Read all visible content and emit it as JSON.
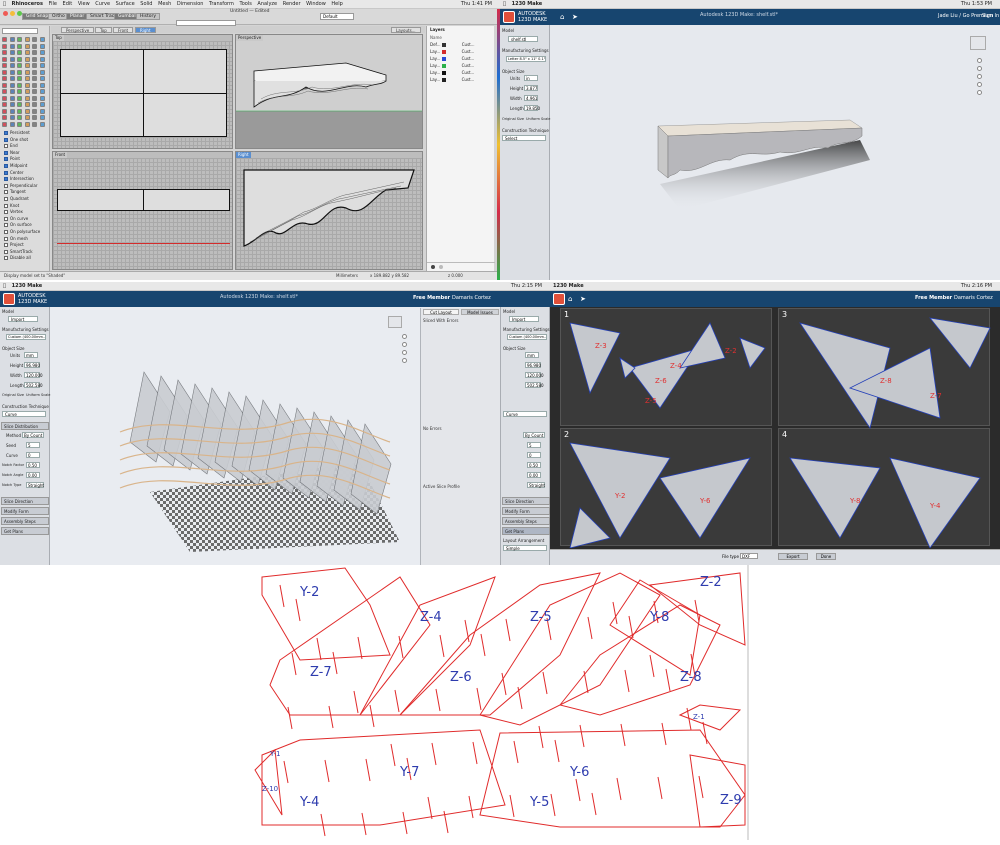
{
  "rhino": {
    "menubar": [
      "Rhinoceros",
      "File",
      "Edit",
      "View",
      "Curve",
      "Surface",
      "Solid",
      "Mesh",
      "Dimension",
      "Transform",
      "Tools",
      "Analyze",
      "Render",
      "Window",
      "Help"
    ],
    "clock": "Thu 1:41 PM",
    "window_title": "Untitled — Edited",
    "toolbar_tabs": [
      "Grid Snap",
      "Ortho",
      "Planar",
      "Smart Track",
      "Gumball",
      "History"
    ],
    "command_value": "Default",
    "viewport_tabs": [
      "Perspective",
      "Top",
      "Front",
      "Right",
      "Layouts..."
    ],
    "viewports": [
      "Top",
      "Perspective",
      "Front",
      "Right"
    ],
    "osnaps": [
      "Persistent",
      "One shot",
      "End",
      "Near",
      "Point",
      "Midpoint",
      "Center",
      "Intersection",
      "Perpendicular",
      "Tangent",
      "Quadrant",
      "Knot",
      "Vertex",
      "On curve",
      "On surface",
      "On polysurface",
      "On mesh",
      "Project",
      "SmartTrack",
      "Disable all"
    ],
    "layers_header": "Layers",
    "layers_name_col": "Name",
    "layers": [
      {
        "name": "Def...",
        "mat": "Cust...",
        "color": "#333333"
      },
      {
        "name": "Lay...",
        "mat": "Cust...",
        "color": "#d42b2b"
      },
      {
        "name": "Lay...",
        "mat": "Cust...",
        "color": "#2b4ad4"
      },
      {
        "name": "Lay...",
        "mat": "Cust...",
        "color": "#2bb04a"
      },
      {
        "name": "Lay...",
        "mat": "Cust...",
        "color": "#111111"
      },
      {
        "name": "Lay...",
        "mat": "Cust...",
        "color": "#222222"
      }
    ],
    "status": "Display model set to \"Shaded\"",
    "status_units": "Millimeters",
    "status_coords": "x 189.882   y 89.582",
    "status_z": "z 0.000"
  },
  "make1": {
    "menubar": [
      "1230 Make"
    ],
    "clock": "Thu 1:53 PM",
    "brand_top": "AUTODESK",
    "brand_bottom": "123D MAKE",
    "title": "Autodesk 123D Make: shelf.stl*",
    "user": "Jade Liu / Go Premium",
    "signin": "Sign In",
    "model_label": "Model",
    "import_btn": "shelf.stl",
    "manufacturing_label": "Manufacturing Settings",
    "manufacturing_value": "Letter 8.5\" x 11\" 0.1\"",
    "object_size": "Object Size",
    "units_label": "Units",
    "units_value": "in",
    "height_label": "Height",
    "height_value": "3.877",
    "width_label": "Width",
    "width_value": "4.961",
    "length_label": "Length",
    "length_value": "19.850",
    "original_size": "Original Size",
    "uniform_scale": "Uniform Scale",
    "technique_label": "Construction Technique",
    "technique_value": "Select"
  },
  "make2": {
    "menubar": [
      "1230 Make"
    ],
    "clock": "Thu 2:15 PM",
    "brand_top": "AUTODESK",
    "brand_bottom": "123D MAKE",
    "title": "Autodesk 123D Make: shelf.stl*",
    "member": "Free Member",
    "user": "Damaris Cortez",
    "model_label": "Model",
    "import_btn": "Import",
    "manufacturing_label": "Manufacturing Settings",
    "manufacturing_value": "Custom (400.00mm...",
    "object_size": "Object Size",
    "units_label": "Units",
    "units_value": "mm",
    "height_label": "Height",
    "height_value": "96.980",
    "width_label": "Width",
    "width_value": "120.000",
    "length_label": "Length",
    "length_value": "502.580",
    "original_size": "Original Size",
    "uniform_scale": "Uniform Scale",
    "technique_label": "Construction Technique",
    "technique_value": "Curve",
    "slice_dist": "Slice Distribution",
    "method_label": "Method",
    "method_value": "By Count",
    "first_label": "Seed",
    "first_value": "5",
    "curve_label": "Curve",
    "curve_value": "0",
    "notch_factor_label": "Notch Factor",
    "notch_factor_value": "0.50",
    "notch_angle_label": "Notch Angle",
    "notch_angle_value": "0.00",
    "notch_type_label": "Notch Type",
    "notch_type_value": "Straight",
    "slice_direction": "Slice Direction",
    "modify_form": "Modify Form",
    "assembly_steps": "Assembly Steps",
    "get_plans": "Get Plans",
    "mid_tabs": [
      "Cut Layout",
      "Model Issues"
    ],
    "mid_sections": [
      "Sliced With Errors",
      "No Errors",
      "Active Slice Profile"
    ]
  },
  "make3": {
    "menubar": [
      "1230 Make"
    ],
    "clock": "Thu 2:16 PM",
    "member": "Free Member",
    "user": "Damaris Cortez",
    "model_label": "Model",
    "import_btn": "Import",
    "manufacturing_label": "Manufacturing Settings",
    "manufacturing_value": "Custom (400.00mm...",
    "object_size": "Object Size",
    "units_value": "mm",
    "height_value": "96.980",
    "width_value": "120.000",
    "length_value": "502.580",
    "technique_value": "Curve",
    "method_value": "By Count",
    "first_value": "5",
    "curve_value": "0",
    "notch_factor_value": "0.50",
    "notch_angle_value": "0.00",
    "notch_type_value": "Straight",
    "slice_direction": "Slice Direction",
    "modify_form": "Modify Form",
    "assembly_steps": "Assembly Steps",
    "get_plans": "Get Plans",
    "layout_arrangement": "Layout Arrangement",
    "layout_value": "Simple",
    "sheets": [
      "1",
      "2",
      "3",
      "4"
    ],
    "file_type": "File type",
    "file_type_value": "DXF",
    "export_btn": "Export",
    "done_btn": "Done",
    "piece_labels": [
      {
        "sheet": 0,
        "text": "Z-3"
      },
      {
        "sheet": 0,
        "text": "Z-2"
      },
      {
        "sheet": 0,
        "text": "Z-6"
      },
      {
        "sheet": 0,
        "text": "Z-4"
      },
      {
        "sheet": 0,
        "text": "Z-5"
      },
      {
        "sheet": 1,
        "text": "Z-8"
      },
      {
        "sheet": 1,
        "text": "Z-7"
      },
      {
        "sheet": 2,
        "text": "Y-2"
      },
      {
        "sheet": 2,
        "text": "Y-6"
      },
      {
        "sheet": 3,
        "text": "Y-8"
      },
      {
        "sheet": 3,
        "text": "Y-4"
      }
    ]
  },
  "plan_labels": [
    "Y-2",
    "Z-4",
    "Z-5",
    "Z-2",
    "Y-8",
    "Z-7",
    "Z-6",
    "Z-8",
    "Z-1",
    "Y-1",
    "Y-7",
    "Y-6",
    "Z-10",
    "Y-4",
    "Y-5",
    "Z-9"
  ],
  "colors": {
    "cut_line": "#e02b2b",
    "label_ink": "#2e3cae",
    "make_header": "#17456f",
    "rhino_active": "#5a8fd0"
  }
}
